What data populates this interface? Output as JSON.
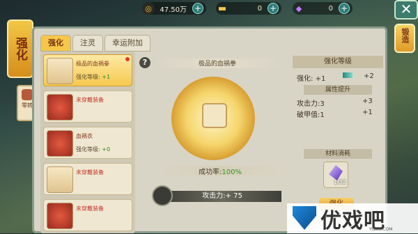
{
  "topbar": {
    "coins": "47.50万",
    "ingots": "0",
    "feathers": "0"
  },
  "left_badge": "强化",
  "side_tab": "零转",
  "right_button": "锻造",
  "tabs": [
    "强化",
    "注灵",
    "幸运附加"
  ],
  "items": [
    {
      "name": "极品的血祸拳",
      "level_label": "强化等级:",
      "level": "+1",
      "equipped": true
    },
    {
      "name": "未穿戴装备",
      "level_label": "",
      "level": "",
      "equipped": false
    },
    {
      "name": "血祸衣",
      "level_label": "强化等级:",
      "level": "+0",
      "equipped": true
    },
    {
      "name": "未穿戴装备",
      "level_label": "",
      "level": "",
      "equipped": false
    },
    {
      "name": "未穿戴装备",
      "level_label": "",
      "level": "",
      "equipped": false
    }
  ],
  "center": {
    "title": "极品的血祸拳",
    "success_label": "成功率:",
    "success_value": "100%",
    "attack_line": "攻击力:+ 75"
  },
  "right_panel": {
    "header": "强化等级",
    "level_label": "强化:",
    "level_from": "+1",
    "level_to": "+2",
    "attr_header": "属性提升",
    "attrs": [
      {
        "label": "攻击力:3",
        "value": "+3"
      },
      {
        "label": "破甲值:1",
        "value": "+1"
      }
    ],
    "material_header": "材料消耗",
    "material_count": "1/32",
    "forge_label": "强化"
  },
  "watermark": {
    "text": "优戏吧",
    "url": "YOXI8.COM"
  },
  "colors": {
    "accent": "#f5c74a",
    "green": "#2d9a22",
    "panel": "#d9d5c6"
  }
}
